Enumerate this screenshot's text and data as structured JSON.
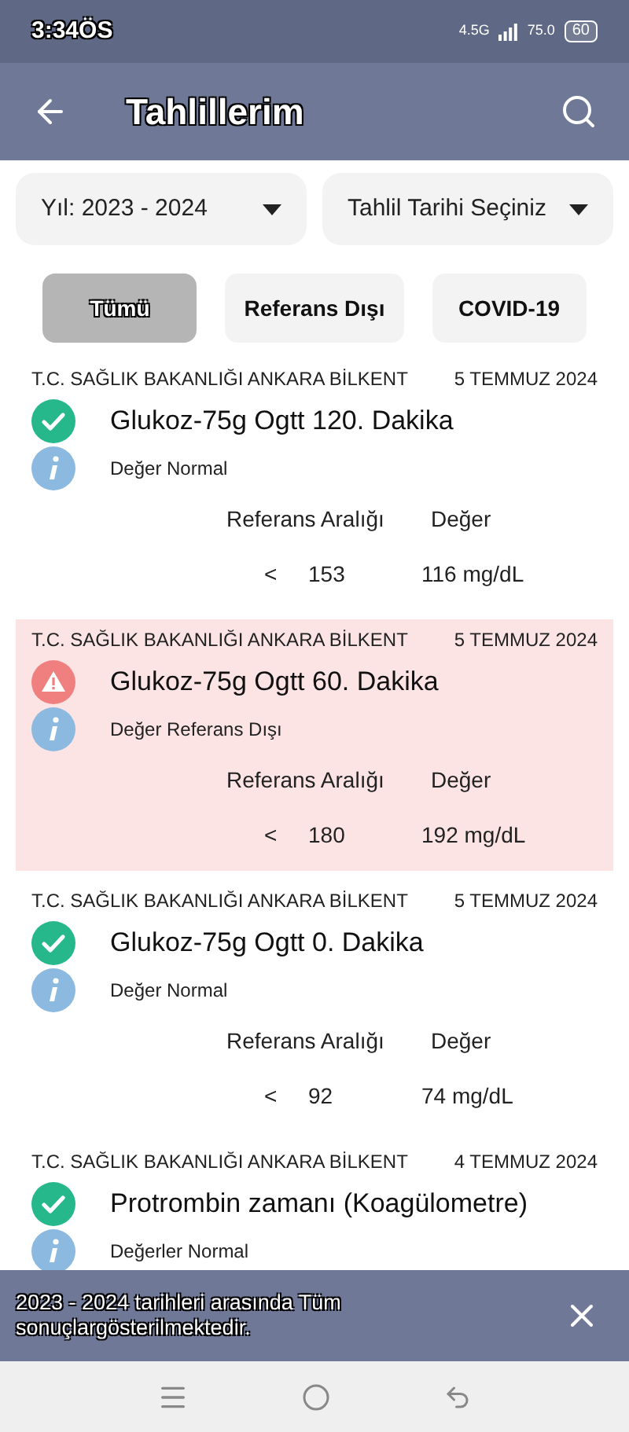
{
  "status_bar": {
    "time": "3:34ÖS",
    "network": "4.5G",
    "speed": "75.0",
    "battery": "60"
  },
  "app_bar": {
    "title": "Tahlillerim"
  },
  "filters": [
    {
      "label": "Yıl: 2023 - 2024"
    },
    {
      "label": "Tahlil Tarihi Seçiniz"
    }
  ],
  "chips": [
    {
      "label": "Tümü",
      "selected": true
    },
    {
      "label": "Referans Dışı",
      "selected": false
    },
    {
      "label": "COVID-19",
      "selected": false
    }
  ],
  "results": [
    {
      "institution": "T.C. SAĞLIK BAKANLIĞI ANKARA BİLKENT",
      "date": "5 TEMMUZ 2024",
      "test": "Glukoz-75g Ogtt 120. Dakika",
      "out_of_range": false,
      "note": "Değer Normal",
      "range_header": "Referans Aralığı",
      "value_header": "Değer",
      "operator": "<",
      "limit": "153",
      "value": "116 mg/dL"
    },
    {
      "institution": "T.C. SAĞLIK BAKANLIĞI ANKARA BİLKENT",
      "date": "5 TEMMUZ 2024",
      "test": "Glukoz-75g Ogtt 60. Dakika",
      "out_of_range": true,
      "note": "Değer Referans Dışı",
      "range_header": "Referans Aralığı",
      "value_header": "Değer",
      "operator": "<",
      "limit": "180",
      "value": "192 mg/dL"
    },
    {
      "institution": "T.C. SAĞLIK BAKANLIĞI ANKARA BİLKENT",
      "date": "5 TEMMUZ 2024",
      "test": "Glukoz-75g Ogtt 0. Dakika",
      "out_of_range": false,
      "note": "Değer Normal",
      "range_header": "Referans Aralığı",
      "value_header": "Değer",
      "operator": "<",
      "limit": "92",
      "value": "74 mg/dL"
    },
    {
      "institution": "T.C. SAĞLIK BAKANLIĞI ANKARA BİLKENT",
      "date": "4 TEMMUZ 2024",
      "test": "Protrombin zamanı (Koagülometre)",
      "out_of_range": false,
      "note": "Değerler Normal"
    }
  ],
  "snackbar": {
    "message": "2023 - 2024 tarihleri arasında Tüm sonuçlargösterilmektedir."
  }
}
